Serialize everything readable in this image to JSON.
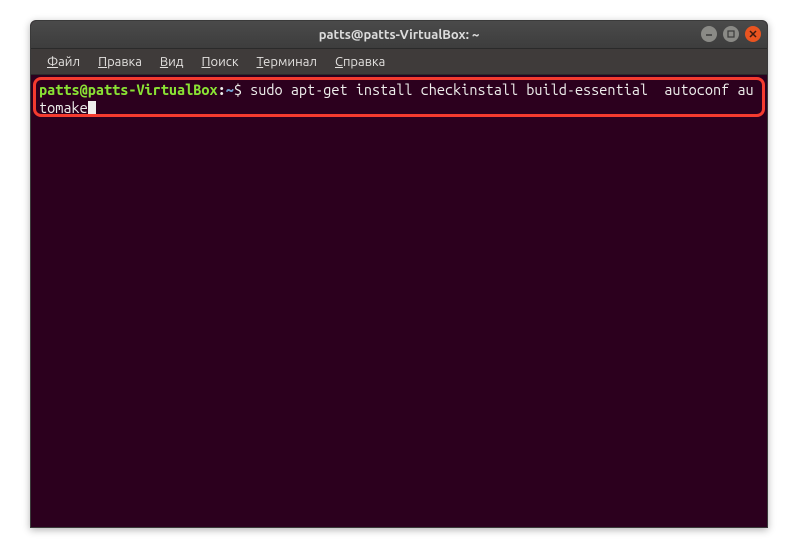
{
  "window": {
    "title": "patts@patts-VirtualBox: ~"
  },
  "menubar": {
    "items": [
      "Файл",
      "Правка",
      "Вид",
      "Поиск",
      "Терминал",
      "Справка"
    ]
  },
  "terminal": {
    "prompt_user_host": "patts@patts-VirtualBox",
    "prompt_colon": ":",
    "prompt_path": "~",
    "prompt_dollar": "$ ",
    "command": "sudo apt-get install checkinstall build-essential  autoconf automake"
  },
  "colors": {
    "close_button": "#e95420",
    "highlight_border": "#f43b2f",
    "prompt_user": "#8ae234",
    "prompt_path": "#729fcf",
    "terminal_bg": "#2c001e"
  }
}
